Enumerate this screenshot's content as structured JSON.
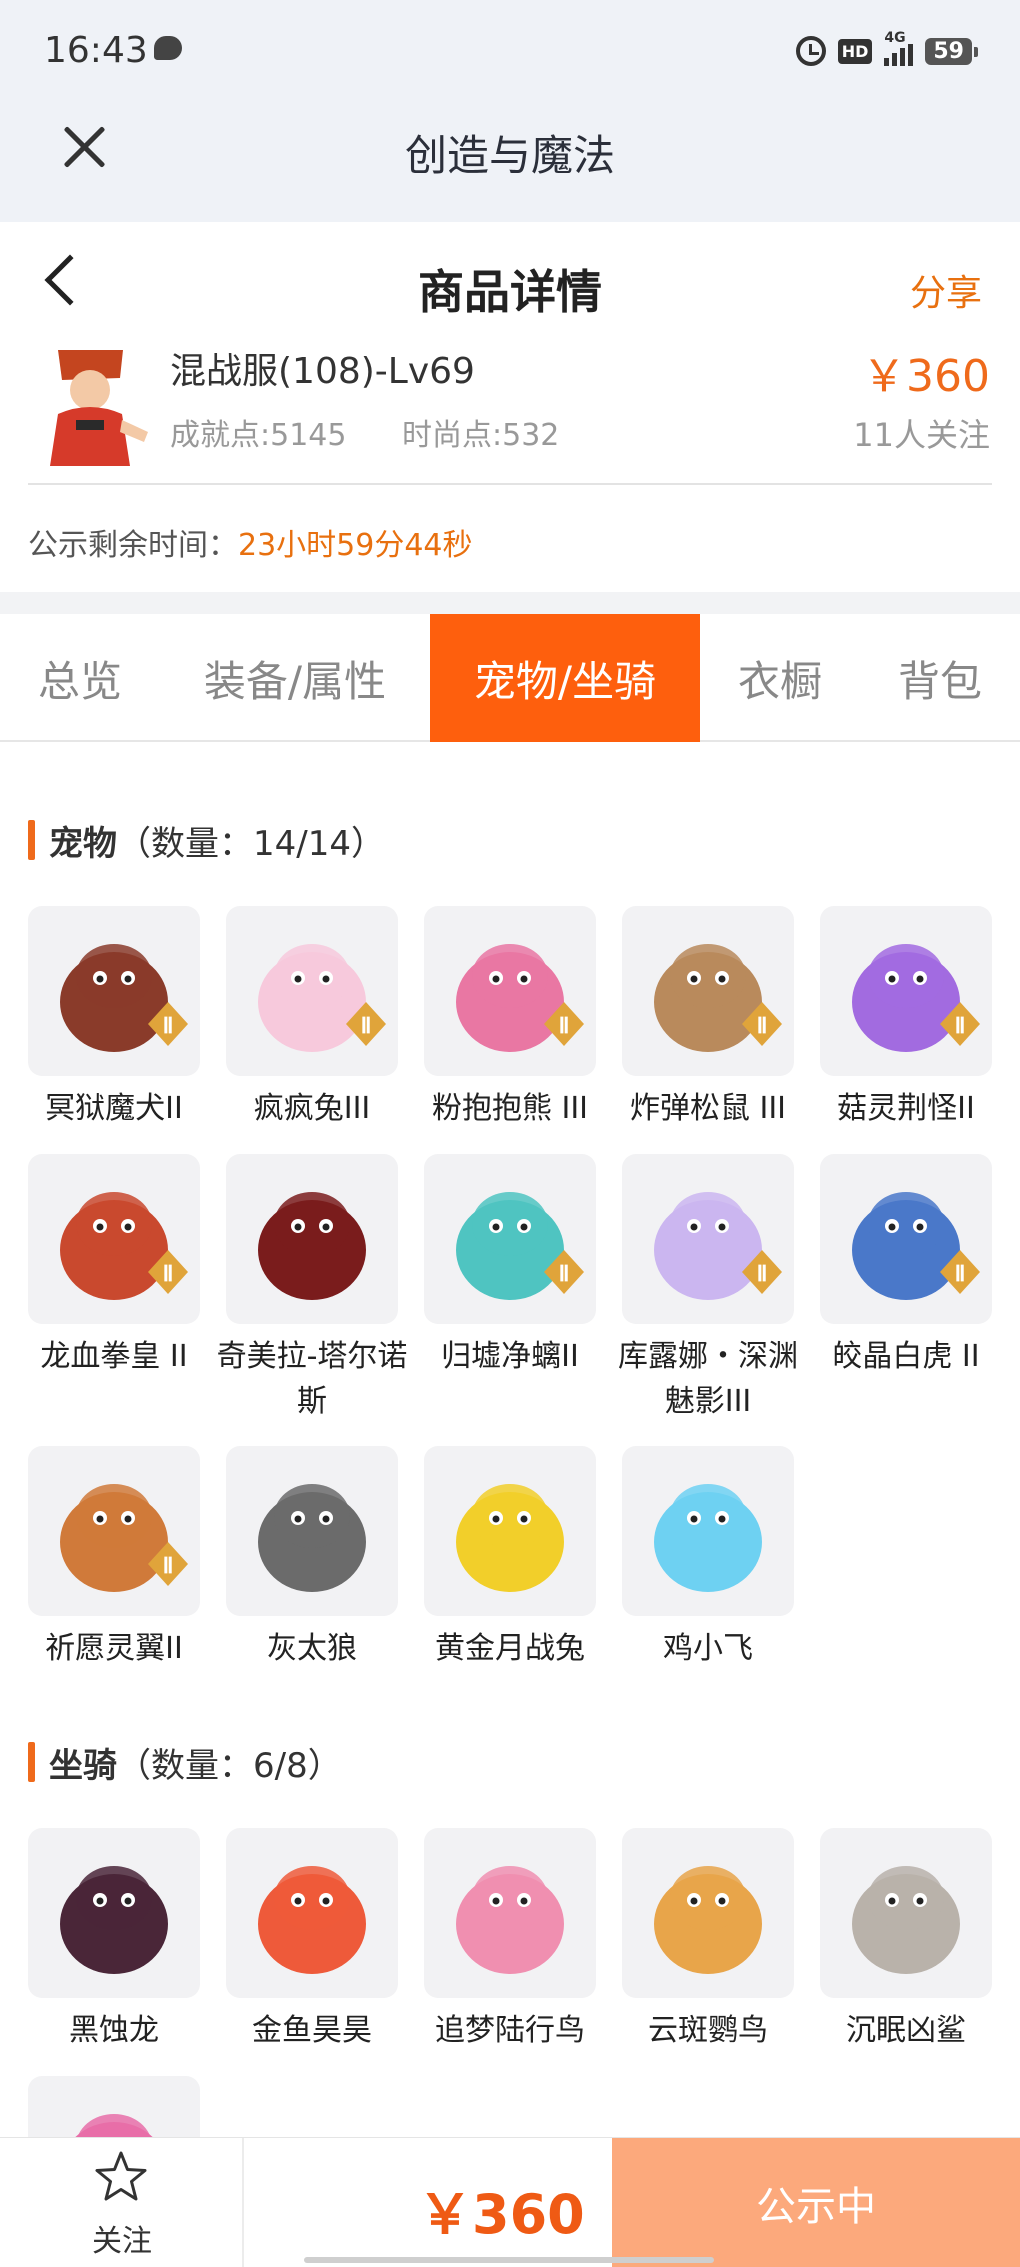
{
  "status_bar": {
    "time": "16:43",
    "hd": "HD",
    "network": "4G",
    "battery": "59"
  },
  "app_bar": {
    "title": "创造与魔法"
  },
  "header": {
    "title": "商品详情",
    "share_label": "分享"
  },
  "product": {
    "name": "混战服(108)-Lv69",
    "achievement": "成就点:5145",
    "fashion": "时尚点:532",
    "price": "￥360",
    "watchers": "11人关注"
  },
  "notice": {
    "label": "公示剩余时间：",
    "countdown": "23小时59分44秒"
  },
  "tabs": [
    {
      "label": "总览",
      "active": false
    },
    {
      "label": "装备/属性",
      "active": false
    },
    {
      "label": "宠物/坐骑",
      "active": true
    },
    {
      "label": "衣橱",
      "active": false
    },
    {
      "label": "背包",
      "active": false
    }
  ],
  "pets_section": {
    "title": "宠物",
    "count": "（数量：14/14）"
  },
  "pets": [
    {
      "name": "冥狱魔犬II",
      "icon": "dragon-dog-icon",
      "color": "#8a3b2a"
    },
    {
      "name": "疯疯兔III",
      "icon": "rabbit-icon",
      "color": "#f7c9dc"
    },
    {
      "name": "粉抱抱熊 III",
      "icon": "bear-icon",
      "color": "#e977a3"
    },
    {
      "name": "炸弹松鼠 III",
      "icon": "squirrel-icon",
      "color": "#b98a5c"
    },
    {
      "name": "菇灵荆怪II",
      "icon": "mushroom-sprite-icon",
      "color": "#a26be0"
    },
    {
      "name": "龙血拳皇 II",
      "icon": "dragon-boxer-icon",
      "color": "#c9492e"
    },
    {
      "name": "奇美拉-塔尔诺斯",
      "icon": "chimera-icon",
      "color": "#7a1c1c"
    },
    {
      "name": "归墟净螭II",
      "icon": "water-dragon-icon",
      "color": "#4fc4c1"
    },
    {
      "name": "库露娜・深渊魅影III",
      "icon": "abyss-girl-icon",
      "color": "#cbb6f0"
    },
    {
      "name": "皎晶白虎 II",
      "icon": "white-tiger-icon",
      "color": "#4a78c9"
    },
    {
      "name": "祈愿灵翼II",
      "icon": "griffin-icon",
      "color": "#d07a3a"
    },
    {
      "name": "灰太狼",
      "icon": "grey-wolf-icon",
      "color": "#6b6b6b"
    },
    {
      "name": "黄金月战兔",
      "icon": "golden-rabbit-icon",
      "color": "#f2cf2a"
    },
    {
      "name": "鸡小飞",
      "icon": "chick-icon",
      "color": "#6ed1f2"
    }
  ],
  "mounts_section": {
    "title": "坐骑",
    "count": "（数量：6/8）"
  },
  "mounts": [
    {
      "name": "黑蚀龙",
      "icon": "black-dragon-icon",
      "color": "#4a2638"
    },
    {
      "name": "金鱼昊昊",
      "icon": "goldfish-icon",
      "color": "#ee5a3a"
    },
    {
      "name": "追梦陆行鸟",
      "icon": "runner-bird-icon",
      "color": "#f08fb0"
    },
    {
      "name": "云斑鹦鸟",
      "icon": "parrot-icon",
      "color": "#e8a54a"
    },
    {
      "name": "沉眠凶鲨",
      "icon": "shark-icon",
      "color": "#b9b2aa"
    },
    {
      "name": "",
      "icon": "pink-mount-icon",
      "color": "#e86fa8"
    }
  ],
  "bottom_bar": {
    "follow_label": "关注",
    "price": "￥360",
    "status": "公示中"
  },
  "colors": {
    "accent": "#fe5f0d",
    "price": "#ef6a1b",
    "status_button": "#fca97c"
  }
}
